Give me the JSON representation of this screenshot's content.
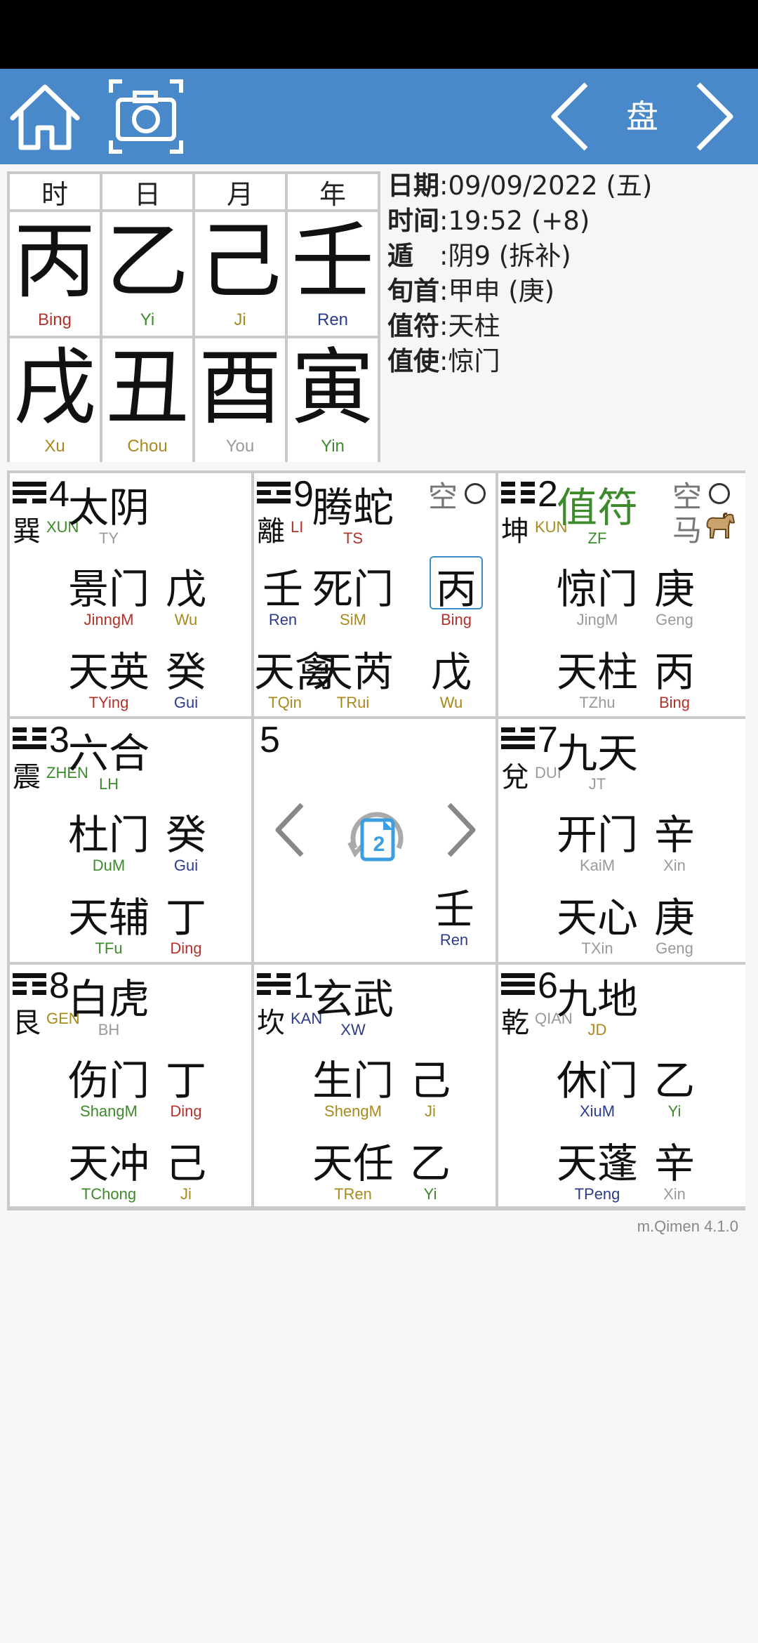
{
  "header": {
    "title": "盘"
  },
  "pillars": [
    {
      "label": "时",
      "stem": "丙",
      "stem_py": "Bing",
      "stem_color": "#b0322c",
      "branch": "戌",
      "branch_py": "Xu",
      "branch_color": "#a88a1c"
    },
    {
      "label": "日",
      "stem": "乙",
      "stem_py": "Yi",
      "stem_color": "#3d8a2c",
      "branch": "丑",
      "branch_py": "Chou",
      "branch_color": "#a88a1c"
    },
    {
      "label": "月",
      "stem": "己",
      "stem_py": "Ji",
      "stem_color": "#a88a1c",
      "branch": "酉",
      "branch_py": "You",
      "branch_color": "#9a9a9a"
    },
    {
      "label": "年",
      "stem": "壬",
      "stem_py": "Ren",
      "stem_color": "#2c3b8a",
      "branch": "寅",
      "branch_py": "Yin",
      "branch_color": "#3d8a2c"
    }
  ],
  "info": [
    {
      "key": "日期",
      "value": ":09/09/2022 (五)"
    },
    {
      "key": "时间",
      "value": ":19:52 (+8)"
    },
    {
      "key": "遁　",
      "value": ":阴9 (拆补)"
    },
    {
      "key": "旬首",
      "value": ":甲申 (庚)"
    },
    {
      "key": "值符",
      "value": ":天柱"
    },
    {
      "key": "值使",
      "value": ":惊门"
    }
  ],
  "palaces": {
    "xun": {
      "num": "4",
      "gua": "巽",
      "gua_py": "XUN",
      "gua_color": "#3d8a2c",
      "god": "太阴",
      "god_py": "TY",
      "god_color": "#9a9a9a",
      "door": "景门",
      "door_py": "JinngM",
      "door_color": "#b0322c",
      "heaven_stem": "戊",
      "heaven_stem_py": "Wu",
      "heaven_stem_color": "#a88a1c",
      "star": "天英",
      "star_py": "TYing",
      "star_color": "#b0322c",
      "earth_stem": "癸",
      "earth_stem_py": "Gui",
      "earth_stem_color": "#2c3b8a"
    },
    "li": {
      "num": "9",
      "gua": "離",
      "gua_py": "LI",
      "gua_color": "#b0322c",
      "god": "腾蛇",
      "god_py": "TS",
      "god_color": "#b0322c",
      "kong": "空",
      "extra": "壬",
      "extra_py": "Ren",
      "extra_color": "#2c3b8a",
      "door": "死门",
      "door_py": "SiM",
      "door_color": "#a88a1c",
      "heaven_stem": "丙",
      "heaven_stem_py": "Bing",
      "heaven_stem_color": "#b0322c",
      "extra2": "天禽",
      "extra2_py": "TQin",
      "extra2_color": "#a88a1c",
      "star": "天芮",
      "star_py": "TRui",
      "star_color": "#a88a1c",
      "earth_stem": "戊",
      "earth_stem_py": "Wu",
      "earth_stem_color": "#a88a1c"
    },
    "kun": {
      "num": "2",
      "gua": "坤",
      "gua_py": "KUN",
      "gua_color": "#a88a1c",
      "god": "值符",
      "god_py": "ZF",
      "god_color": "#3d8a2c",
      "kong": "空",
      "ma": "马",
      "door": "惊门",
      "door_py": "JingM",
      "door_color": "#9a9a9a",
      "heaven_stem": "庚",
      "heaven_stem_py": "Geng",
      "heaven_stem_color": "#9a9a9a",
      "star": "天柱",
      "star_py": "TZhu",
      "star_color": "#9a9a9a",
      "earth_stem": "丙",
      "earth_stem_py": "Bing",
      "earth_stem_color": "#b0322c"
    },
    "zhen": {
      "num": "3",
      "gua": "震",
      "gua_py": "ZHEN",
      "gua_color": "#3d8a2c",
      "god": "六合",
      "god_py": "LH",
      "god_color": "#3d8a2c",
      "door": "杜门",
      "door_py": "DuM",
      "door_color": "#3d8a2c",
      "heaven_stem": "癸",
      "heaven_stem_py": "Gui",
      "heaven_stem_color": "#2c3b8a",
      "star": "天辅",
      "star_py": "TFu",
      "star_color": "#3d8a2c",
      "earth_stem": "丁",
      "earth_stem_py": "Ding",
      "earth_stem_color": "#b0322c"
    },
    "center": {
      "num": "5",
      "stem": "壬",
      "stem_py": "Ren",
      "stem_color": "#2c3b8a",
      "icon_label": "2"
    },
    "dui": {
      "num": "7",
      "gua": "兌",
      "gua_py": "DUI",
      "gua_color": "#9a9a9a",
      "god": "九天",
      "god_py": "JT",
      "god_color": "#9a9a9a",
      "door": "开门",
      "door_py": "KaiM",
      "door_color": "#9a9a9a",
      "heaven_stem": "辛",
      "heaven_stem_py": "Xin",
      "heaven_stem_color": "#9a9a9a",
      "star": "天心",
      "star_py": "TXin",
      "star_color": "#9a9a9a",
      "earth_stem": "庚",
      "earth_stem_py": "Geng",
      "earth_stem_color": "#9a9a9a"
    },
    "gen": {
      "num": "8",
      "gua": "艮",
      "gua_py": "GEN",
      "gua_color": "#a88a1c",
      "god": "白虎",
      "god_py": "BH",
      "god_color": "#9a9a9a",
      "door": "伤门",
      "door_py": "ShangM",
      "door_color": "#3d8a2c",
      "heaven_stem": "丁",
      "heaven_stem_py": "Ding",
      "heaven_stem_color": "#b0322c",
      "star": "天冲",
      "star_py": "TChong",
      "star_color": "#3d8a2c",
      "earth_stem": "己",
      "earth_stem_py": "Ji",
      "earth_stem_color": "#a88a1c"
    },
    "kan": {
      "num": "1",
      "gua": "坎",
      "gua_py": "KAN",
      "gua_color": "#2c3b8a",
      "god": "玄武",
      "god_py": "XW",
      "god_color": "#2c3b8a",
      "door": "生门",
      "door_py": "ShengM",
      "door_color": "#a88a1c",
      "heaven_stem": "己",
      "heaven_stem_py": "Ji",
      "heaven_stem_color": "#a88a1c",
      "star": "天任",
      "star_py": "TRen",
      "star_color": "#a88a1c",
      "earth_stem": "乙",
      "earth_stem_py": "Yi",
      "earth_stem_color": "#3d8a2c"
    },
    "qian": {
      "num": "6",
      "gua": "乾",
      "gua_py": "QIAN",
      "gua_color": "#9a9a9a",
      "god": "九地",
      "god_py": "JD",
      "god_color": "#a88a1c",
      "door": "休门",
      "door_py": "XiuM",
      "door_color": "#2c3b8a",
      "heaven_stem": "乙",
      "heaven_stem_py": "Yi",
      "heaven_stem_color": "#3d8a2c",
      "star": "天蓬",
      "star_py": "TPeng",
      "star_color": "#2c3b8a",
      "earth_stem": "辛",
      "earth_stem_py": "Xin",
      "earth_stem_color": "#9a9a9a"
    }
  },
  "footer": {
    "version": "m.Qimen 4.1.0"
  },
  "icons": {
    "home": "home-icon",
    "camera": "camera-icon",
    "prev": "chevron-left-icon",
    "next": "chevron-right-icon",
    "horse": "horse-icon",
    "rotate": "rotate-document-icon"
  }
}
